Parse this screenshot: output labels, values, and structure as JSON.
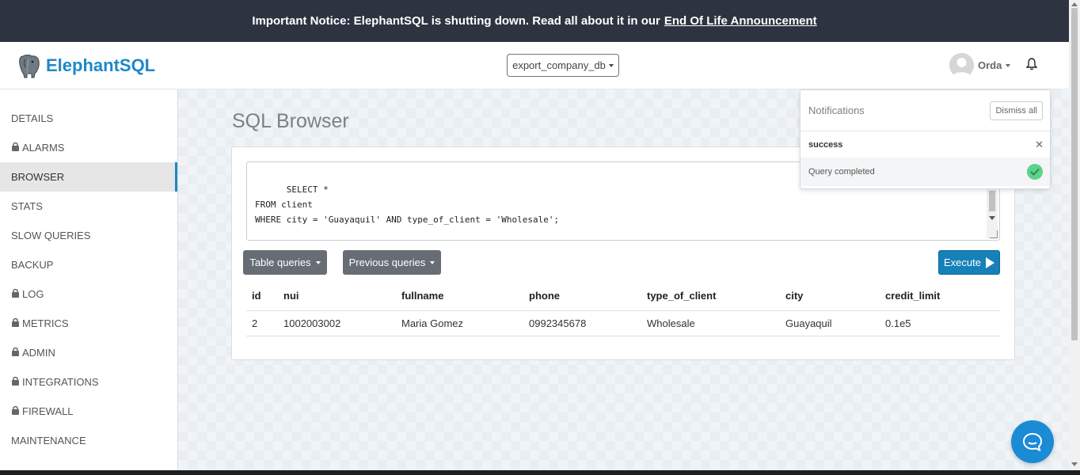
{
  "notice": {
    "text": "Important Notice: ElephantSQL is shutting down. Read all about it in our",
    "link": "End Of Life Announcement"
  },
  "header": {
    "brand": "ElephantSQL",
    "database": "export_company_db",
    "user": "Orda"
  },
  "sidebar": {
    "items": [
      {
        "label": "DETAILS",
        "locked": false
      },
      {
        "label": "ALARMS",
        "locked": true
      },
      {
        "label": "BROWSER",
        "locked": false,
        "active": true
      },
      {
        "label": "STATS",
        "locked": false
      },
      {
        "label": "SLOW QUERIES",
        "locked": false
      },
      {
        "label": "BACKUP",
        "locked": false
      },
      {
        "label": "LOG",
        "locked": true
      },
      {
        "label": "METRICS",
        "locked": true
      },
      {
        "label": "ADMIN",
        "locked": true
      },
      {
        "label": "INTEGRATIONS",
        "locked": true
      },
      {
        "label": "FIREWALL",
        "locked": true
      },
      {
        "label": "MAINTENANCE",
        "locked": false
      }
    ]
  },
  "main": {
    "title": "SQL Browser",
    "query": "SELECT *\nFROM client\nWHERE city = 'Guayaquil' AND type_of_client = 'Wholesale';",
    "table_queries_label": "Table queries",
    "previous_queries_label": "Previous queries",
    "execute_label": "Execute",
    "results": {
      "columns": [
        "id",
        "nui",
        "fullname",
        "phone",
        "type_of_client",
        "city",
        "credit_limit"
      ],
      "rows": [
        [
          "2",
          "1002003002",
          "Maria Gomez",
          "0992345678",
          "Wholesale",
          "Guayaquil",
          "0.1e5"
        ]
      ]
    }
  },
  "notifications": {
    "title": "Notifications",
    "dismiss_label": "Dismiss all",
    "item": {
      "status": "success",
      "message": "Query completed"
    }
  },
  "colors": {
    "accent": "#1e88c7",
    "notice_bg": "#2d3340",
    "success": "#5cd28a",
    "execute": "#1680b8"
  }
}
